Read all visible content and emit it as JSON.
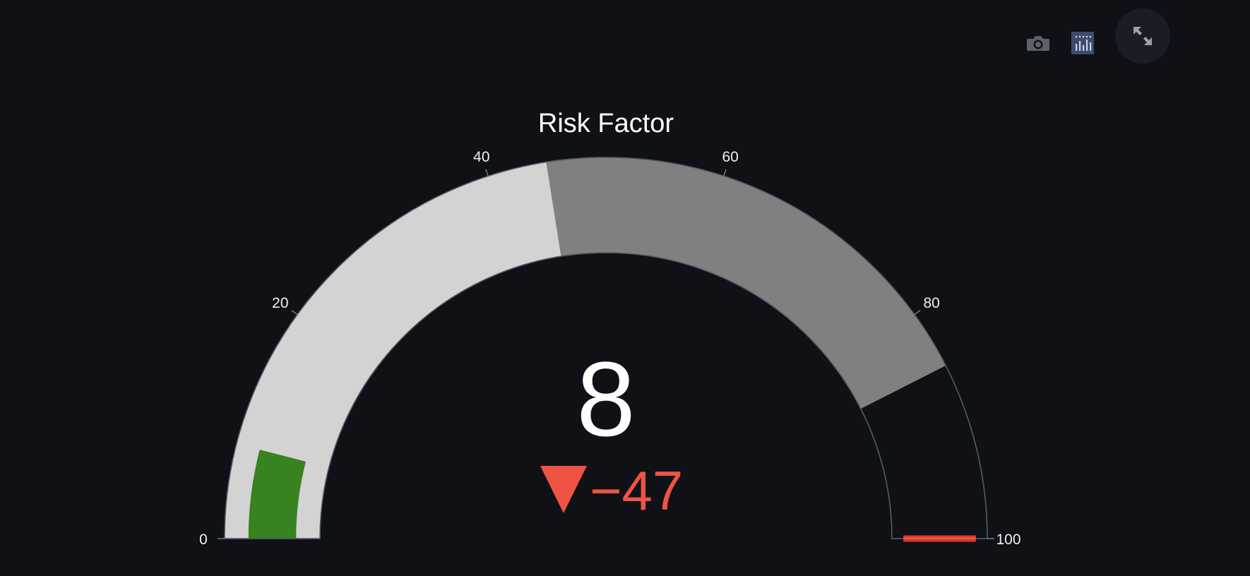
{
  "chart_data": {
    "type": "gauge",
    "title": "Risk Factor",
    "value": 8,
    "delta": -47,
    "delta_text": "−47",
    "axis_range": [
      0,
      100
    ],
    "tick_values": [
      0,
      20,
      40,
      60,
      80,
      100
    ],
    "tick_labels": [
      "0",
      "20",
      "40",
      "60",
      "80",
      "100"
    ],
    "steps": [
      {
        "range": [
          0,
          45
        ],
        "color": "#d3d3d3"
      },
      {
        "range": [
          45,
          85
        ],
        "color": "#808080"
      }
    ],
    "bar_color": "#38821f",
    "threshold": 100,
    "threshold_color": "#e03a2c",
    "number_color": "#ffffff",
    "delta_decreasing_color": "#ef5344",
    "background": "#0f1117"
  },
  "toolbar": {
    "icons": [
      "camera-icon",
      "streamlit-chart-icon",
      "fullscreen-icon"
    ]
  }
}
